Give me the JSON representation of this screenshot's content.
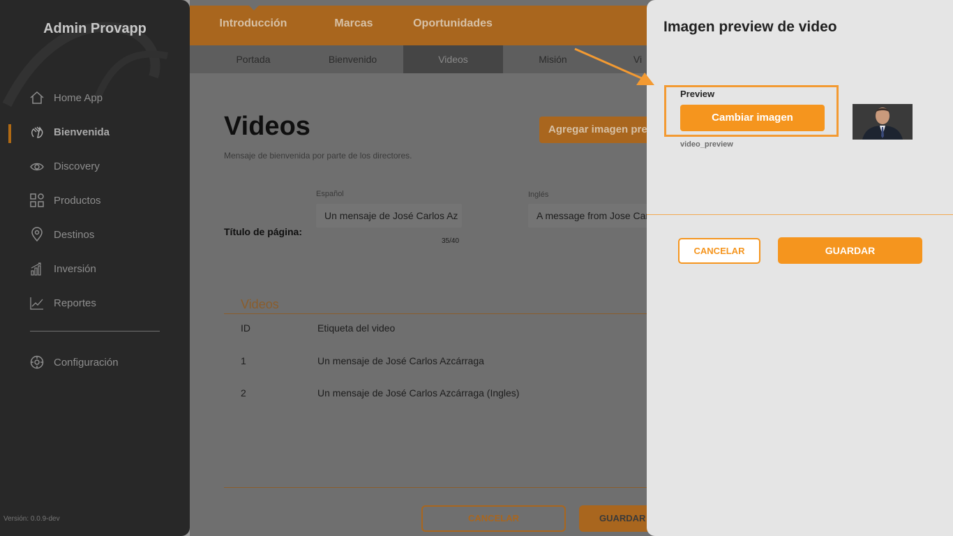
{
  "sidebar": {
    "brand": "Admin Provapp",
    "items": [
      {
        "label": "Home App",
        "icon": "home-icon"
      },
      {
        "label": "Bienvenida",
        "icon": "waving-hand-icon",
        "active": true
      },
      {
        "label": "Discovery",
        "icon": "eye-icon"
      },
      {
        "label": "Productos",
        "icon": "grid-icon"
      },
      {
        "label": "Destinos",
        "icon": "location-pin-icon"
      },
      {
        "label": "Inversión",
        "icon": "bar-chart-icon"
      },
      {
        "label": "Reportes",
        "icon": "trend-chart-icon"
      }
    ],
    "config": {
      "label": "Configuración",
      "icon": "gear-icon"
    },
    "version": "Versión: 0.0.9-dev"
  },
  "topnav": {
    "tabs": [
      "Introducción",
      "Marcas",
      "Oportunidades"
    ]
  },
  "subnav": {
    "tabs": [
      "Portada",
      "Bienvenido",
      "Videos",
      "Misión",
      "Vi"
    ],
    "active": "Videos"
  },
  "main": {
    "title": "Videos",
    "subtitle": "Mensaje de bienvenida por parte de los directores.",
    "add_button": "Agregar imagen pre",
    "row_label": "Título de página:",
    "spanish_label": "Español",
    "english_label": "Inglés",
    "spanish_value": "Un mensaje de José Carlos Az",
    "english_value": "A message from Jose Car",
    "counter": "35/40",
    "videos_section": "Videos",
    "table": {
      "headers": [
        "ID",
        "Etiqueta del video"
      ],
      "rows": [
        {
          "id": "1",
          "label": "Un mensaje de José Carlos Azcárraga"
        },
        {
          "id": "2",
          "label": "Un mensaje de José Carlos Azcárraga (Ingles)"
        }
      ]
    },
    "cancel_button": "CANCELAR",
    "save_button": "GUARDAR"
  },
  "drawer": {
    "title": "Imagen preview de video",
    "preview_label": "Preview",
    "change_button": "Cambiar imagen",
    "file_name": "video_preview",
    "cancel_button": "CANCELAR",
    "save_button": "GUARDAR"
  },
  "colors": {
    "accent": "#f5951e",
    "sidebar_bg": "#282828",
    "drawer_bg": "#e5e5e5"
  }
}
